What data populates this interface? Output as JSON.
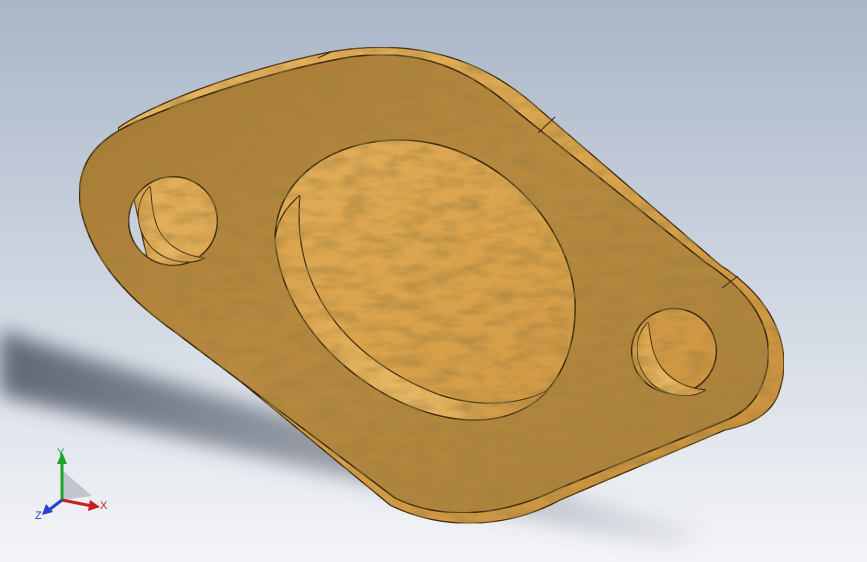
{
  "viewport": {
    "background_top": "#a9b6c8",
    "background_bottom": "#f4f5f8"
  },
  "part": {
    "material_color": "#b8893f",
    "highlight_color": "#e0ad58",
    "edge_color": "#3a2a12"
  },
  "triad": {
    "x_label": "X",
    "y_label": "Y",
    "z_label": "Z",
    "x_color": "#c81e1e",
    "y_color": "#1fa32a",
    "z_color": "#2a3fd0"
  }
}
